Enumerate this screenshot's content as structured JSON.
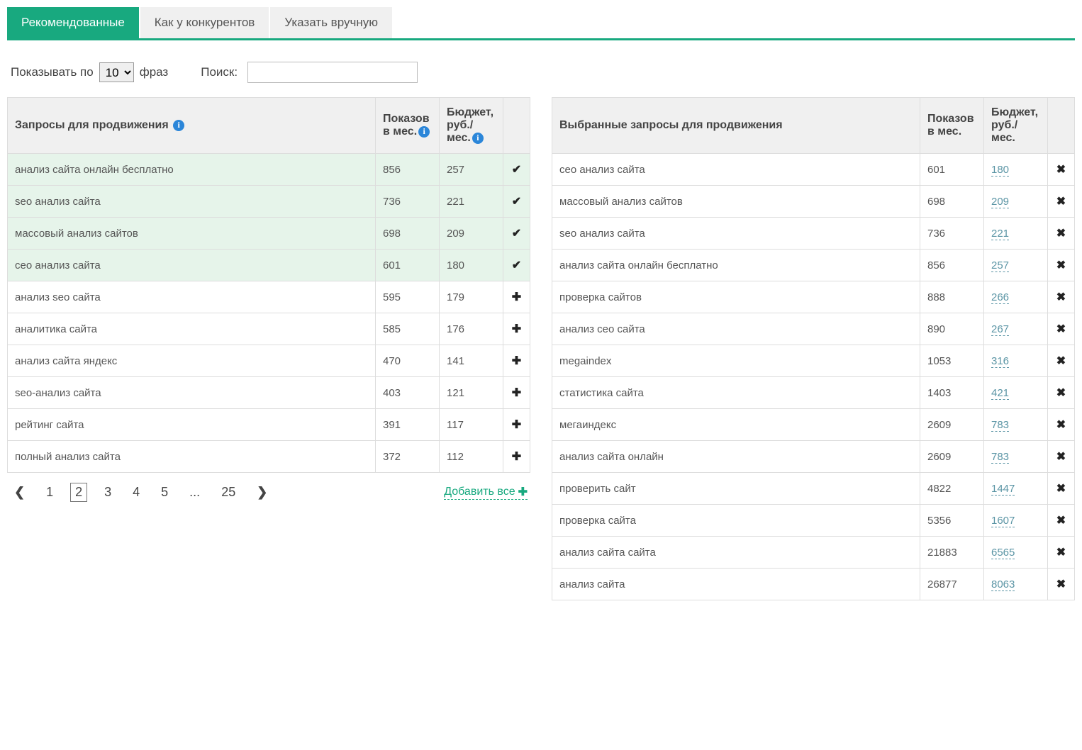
{
  "tabs": [
    {
      "label": "Рекомендованные",
      "active": true
    },
    {
      "label": "Как у конкурентов",
      "active": false
    },
    {
      "label": "Указать вручную",
      "active": false
    }
  ],
  "controls": {
    "show_by_label": "Показывать по",
    "page_size": "10",
    "phrases_label": "фраз",
    "search_label": "Поиск:"
  },
  "left_headers": {
    "queries": "Запросы для продвижения",
    "views": "Показов в мес.",
    "budget": "Бюджет, руб./мес."
  },
  "right_headers": {
    "queries": "Выбранные запросы для продвижения",
    "views": "Показов в мес.",
    "budget": "Бюджет, руб./мес."
  },
  "left_rows": [
    {
      "q": "анализ сайта онлайн бесплатно",
      "views": "856",
      "budget": "257",
      "selected": true
    },
    {
      "q": "seo анализ сайта",
      "views": "736",
      "budget": "221",
      "selected": true
    },
    {
      "q": "массовый анализ сайтов",
      "views": "698",
      "budget": "209",
      "selected": true
    },
    {
      "q": "сео анализ сайта",
      "views": "601",
      "budget": "180",
      "selected": true
    },
    {
      "q": "анализ seo сайта",
      "views": "595",
      "budget": "179",
      "selected": false
    },
    {
      "q": "аналитика сайта",
      "views": "585",
      "budget": "176",
      "selected": false
    },
    {
      "q": "анализ сайта яндекс",
      "views": "470",
      "budget": "141",
      "selected": false
    },
    {
      "q": "seo-анализ сайта",
      "views": "403",
      "budget": "121",
      "selected": false
    },
    {
      "q": "рейтинг сайта",
      "views": "391",
      "budget": "117",
      "selected": false
    },
    {
      "q": "полный анализ сайта",
      "views": "372",
      "budget": "112",
      "selected": false
    }
  ],
  "right_rows": [
    {
      "q": "сео анализ сайта",
      "views": "601",
      "budget": "180"
    },
    {
      "q": "массовый анализ сайтов",
      "views": "698",
      "budget": "209"
    },
    {
      "q": "seo анализ сайта",
      "views": "736",
      "budget": "221"
    },
    {
      "q": "анализ сайта онлайн бесплатно",
      "views": "856",
      "budget": "257"
    },
    {
      "q": "проверка сайтов",
      "views": "888",
      "budget": "266"
    },
    {
      "q": "анализ сео сайта",
      "views": "890",
      "budget": "267"
    },
    {
      "q": "megaindex",
      "views": "1053",
      "budget": "316"
    },
    {
      "q": "статистика сайта",
      "views": "1403",
      "budget": "421"
    },
    {
      "q": "мегаиндекс",
      "views": "2609",
      "budget": "783"
    },
    {
      "q": "анализ сайта онлайн",
      "views": "2609",
      "budget": "783"
    },
    {
      "q": "проверить сайт",
      "views": "4822",
      "budget": "1447"
    },
    {
      "q": "проверка сайта",
      "views": "5356",
      "budget": "1607"
    },
    {
      "q": "анализ сайта сайта",
      "views": "21883",
      "budget": "6565"
    },
    {
      "q": "анализ сайта",
      "views": "26877",
      "budget": "8063"
    }
  ],
  "pager": {
    "pages_visible": [
      "1",
      "2",
      "3",
      "4",
      "5"
    ],
    "ellipsis": "...",
    "last": "25",
    "active": "2"
  },
  "add_all_label": "Добавить все",
  "icons": {
    "check": "✔",
    "plus": "✚",
    "remove": "✖",
    "info": "i",
    "prev": "❮",
    "next": "❯"
  }
}
